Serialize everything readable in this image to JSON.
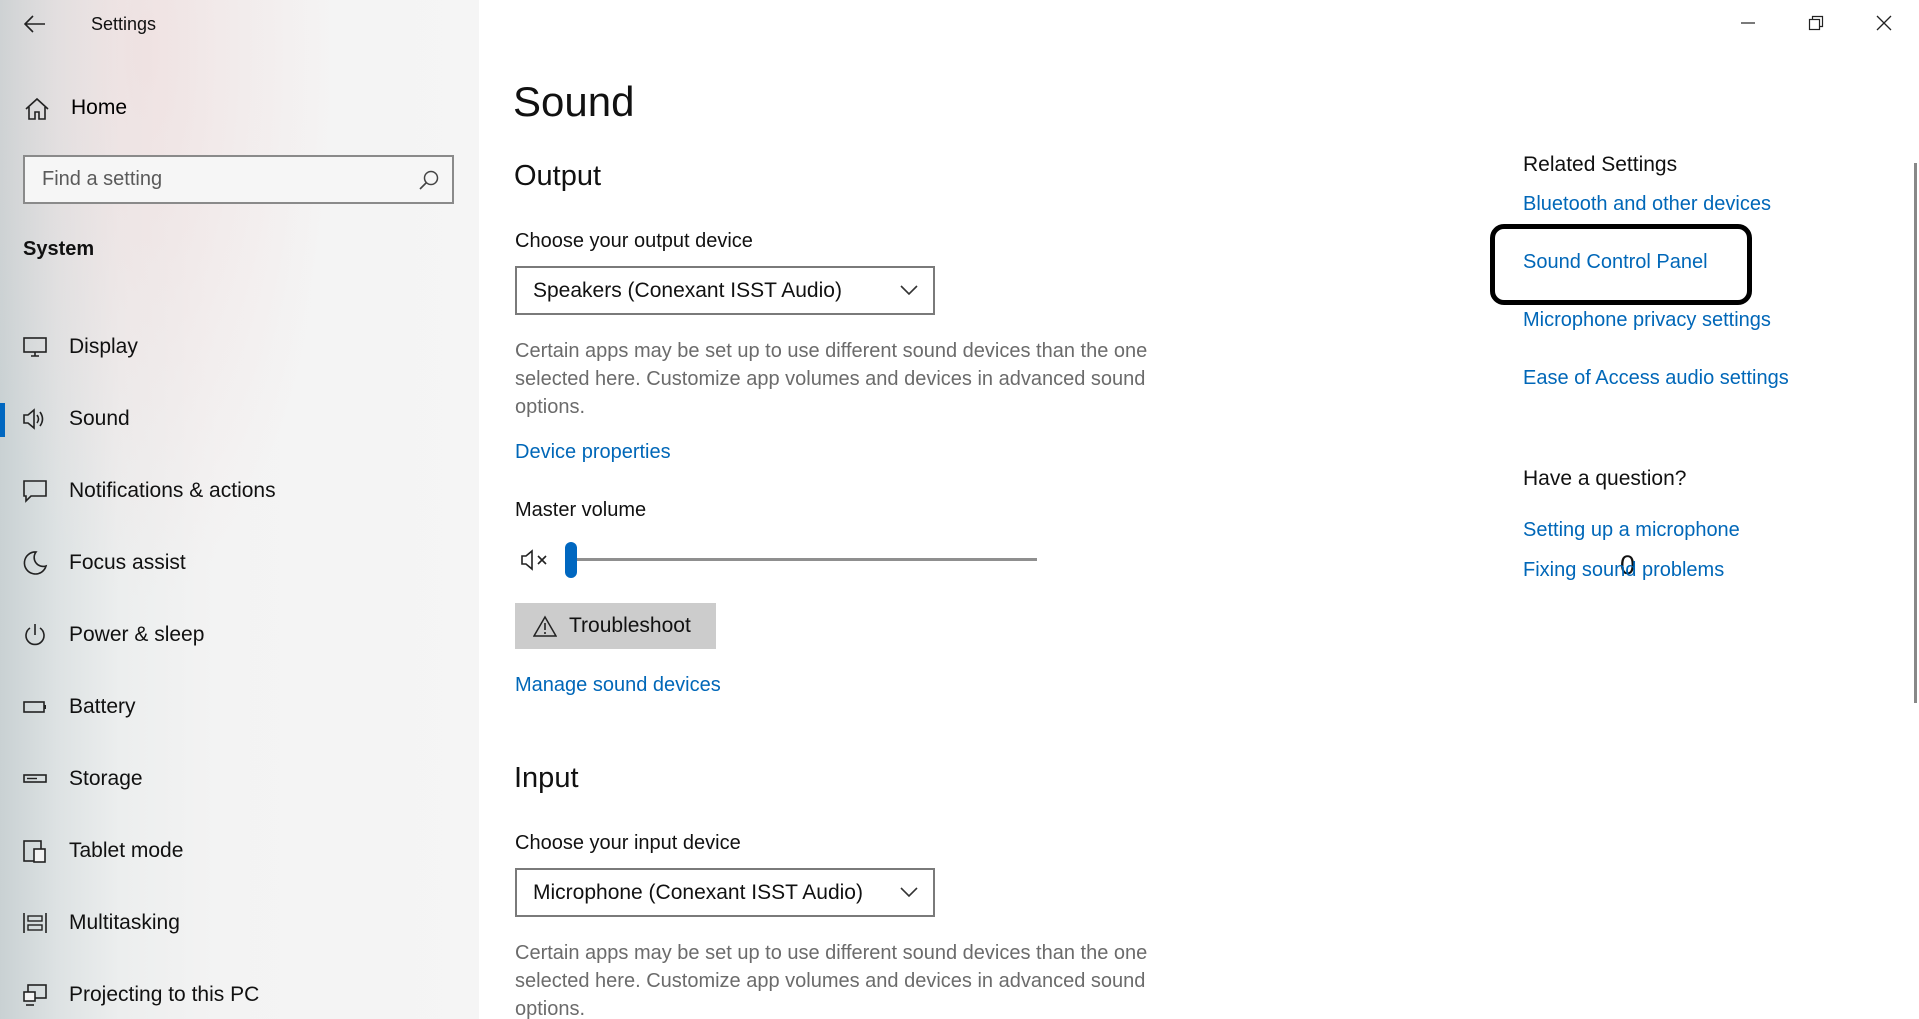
{
  "window": {
    "title": "Settings",
    "controls": {
      "minimize": "minimize-icon",
      "restore": "restore-icon",
      "close": "close-icon"
    }
  },
  "sidebar": {
    "home_label": "Home",
    "search_placeholder": "Find a setting",
    "section": "System",
    "items": [
      {
        "label": "Display",
        "icon": "display-icon",
        "active": false
      },
      {
        "label": "Sound",
        "icon": "speaker-icon",
        "active": true
      },
      {
        "label": "Notifications & actions",
        "icon": "notifications-icon",
        "active": false
      },
      {
        "label": "Focus assist",
        "icon": "moon-icon",
        "active": false
      },
      {
        "label": "Power & sleep",
        "icon": "power-icon",
        "active": false
      },
      {
        "label": "Battery",
        "icon": "battery-icon",
        "active": false
      },
      {
        "label": "Storage",
        "icon": "storage-icon",
        "active": false
      },
      {
        "label": "Tablet mode",
        "icon": "tablet-icon",
        "active": false
      },
      {
        "label": "Multitasking",
        "icon": "multitasking-icon",
        "active": false
      },
      {
        "label": "Projecting to this PC",
        "icon": "projecting-icon",
        "active": false
      }
    ]
  },
  "main": {
    "title": "Sound",
    "output": {
      "heading": "Output",
      "device_label": "Choose your output device",
      "device_value": "Speakers (Conexant ISST Audio)",
      "description": "Certain apps may be set up to use different sound devices than the one selected here. Customize app volumes and devices in advanced sound options.",
      "device_properties_link": "Device properties",
      "master_volume_label": "Master volume",
      "volume_value": "0",
      "volume_fraction": 0,
      "troubleshoot_label": "Troubleshoot",
      "manage_link": "Manage sound devices"
    },
    "input": {
      "heading": "Input",
      "device_label": "Choose your input device",
      "device_value": "Microphone (Conexant ISST Audio)",
      "description": "Certain apps may be set up to use different sound devices than the one selected here. Customize app volumes and devices in advanced sound options."
    }
  },
  "related": {
    "title": "Related Settings",
    "links": [
      "Bluetooth and other devices",
      "Sound Control Panel",
      "Microphone privacy settings",
      "Ease of Access audio settings"
    ],
    "question_title": "Have a question?",
    "question_links": [
      "Setting up a microphone",
      "Fixing sound problems"
    ]
  },
  "colors": {
    "accent": "#0067c0",
    "link": "#0067b8",
    "description": "#6b6b6b"
  }
}
